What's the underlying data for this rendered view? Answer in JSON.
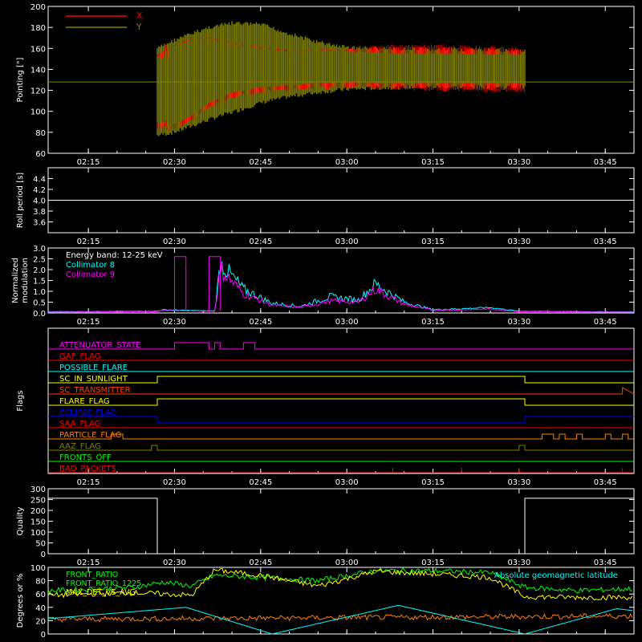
{
  "colors": {
    "background": "#000000",
    "axes": "#ffffff",
    "x_pointing": "#ff0000",
    "y_pointing": "#808000",
    "collimator8": "#00ffff",
    "collimator9": "#ff00ff"
  },
  "time_ticks": [
    "02:15",
    "02:30",
    "02:45",
    "03:00",
    "03:15",
    "03:30",
    "03:45"
  ],
  "chart_data": [
    {
      "type": "line",
      "ylabel": "Pointing [\"]",
      "ylim": [
        60,
        200
      ],
      "yticks": [
        "60",
        "80",
        "100",
        "120",
        "140",
        "160",
        "180",
        "200"
      ],
      "legend": [
        "X",
        "Y"
      ],
      "baseline_y": 128,
      "series": [
        {
          "name": "X",
          "color": "#ff0000",
          "x": [
            "02:27",
            "02:30",
            "02:33",
            "02:36",
            "02:40",
            "02:45",
            "02:50",
            "02:55",
            "03:00",
            "03:05",
            "03:10",
            "03:15",
            "03:20",
            "03:25",
            "03:31"
          ],
          "upper": [
            160,
            168,
            174,
            176,
            170,
            166,
            163,
            164,
            164,
            167,
            168,
            168,
            167,
            166,
            165
          ],
          "lower": [
            78,
            82,
            90,
            102,
            112,
            117,
            119,
            121,
            122,
            121,
            120,
            119,
            119,
            118,
            118
          ]
        },
        {
          "name": "Y",
          "color": "#808000",
          "x": [
            "02:27",
            "02:30",
            "02:33",
            "02:36",
            "02:40",
            "02:45",
            "02:50",
            "02:55",
            "03:00",
            "03:05",
            "03:10",
            "03:15",
            "03:20",
            "03:25",
            "03:31"
          ],
          "upper": [
            162,
            170,
            176,
            182,
            186,
            185,
            176,
            168,
            163,
            162,
            161,
            161,
            161,
            160,
            160
          ],
          "lower": [
            75,
            78,
            84,
            90,
            97,
            106,
            112,
            116,
            119,
            120,
            121,
            121,
            121,
            121,
            121
          ]
        }
      ]
    },
    {
      "type": "line",
      "ylabel": "Roll period [s]",
      "ylim": [
        3.4,
        4.6
      ],
      "yticks": [
        "3.6",
        "3.8",
        "4.0",
        "4.2",
        "4.4"
      ],
      "series": [
        {
          "x": [
            "02:08",
            "03:50"
          ],
          "y": [
            4.0,
            4.0
          ],
          "color": "#ffffff"
        }
      ]
    },
    {
      "type": "line",
      "ylabel": "Normalized modulation",
      "ylim": [
        0,
        3.0
      ],
      "yticks": [
        "0.0",
        "0.5",
        "1.0",
        "1.5",
        "2.0",
        "2.5",
        "3.0"
      ],
      "annotation": "Energy band: 12-25 keV",
      "legend": [
        "Collimator 8",
        "Collimator 9"
      ],
      "series": [
        {
          "name": "Collimator 8",
          "color": "#00ffff",
          "x": [
            "02:08",
            "02:27",
            "02:28",
            "02:35",
            "02:37",
            "02:38",
            "02:42",
            "02:47",
            "02:52",
            "02:57",
            "03:02",
            "03:05",
            "03:10",
            "03:15",
            "03:25",
            "03:30",
            "03:50"
          ],
          "y": [
            0.06,
            0.08,
            0.15,
            0.1,
            0.1,
            2.3,
            1.1,
            0.45,
            0.3,
            0.75,
            0.6,
            1.35,
            0.5,
            0.15,
            0.25,
            0.08,
            0.05
          ]
        },
        {
          "name": "Collimator 9",
          "color": "#ff00ff",
          "x": [
            "02:08",
            "02:27",
            "02:28",
            "02:35",
            "02:37",
            "02:38",
            "02:42",
            "02:47",
            "02:52",
            "02:57",
            "03:02",
            "03:05",
            "03:10",
            "03:15",
            "03:25",
            "03:30",
            "03:50"
          ],
          "y": [
            0.04,
            0.06,
            0.12,
            0.08,
            0.08,
            2.0,
            0.9,
            0.35,
            0.25,
            0.55,
            0.5,
            1.1,
            0.4,
            0.12,
            0.18,
            0.06,
            0.04
          ]
        }
      ]
    },
    {
      "type": "line",
      "ylabel": "Flags",
      "flags": [
        {
          "label": "ATTENUATOR_STATE",
          "color": "#ff00ff"
        },
        {
          "label": "GAP_FLAG",
          "color": "#ff0000"
        },
        {
          "label": "POSSIBLE_FLARE",
          "color": "#00ffff"
        },
        {
          "label": "SC_IN_SUNLIGHT",
          "color": "#ffff00"
        },
        {
          "label": "SC_TRANSMITTER",
          "color": "#ff4000"
        },
        {
          "label": "FLARE_FLAG",
          "color": "#ffff00"
        },
        {
          "label": "ECLIPSE_FLAG",
          "color": "#0000ff"
        },
        {
          "label": "SAA_FLAG",
          "color": "#ff0000"
        },
        {
          "label": "PARTICLE_FLAG",
          "color": "#ff8000"
        },
        {
          "label": "AAZ_FLAG",
          "color": "#808000"
        },
        {
          "label": "FRONTS_OFF",
          "color": "#00ff00"
        },
        {
          "label": "BAD_PACKETS",
          "color": "#ff0000"
        }
      ]
    },
    {
      "type": "line",
      "ylabel": "Quality",
      "ylim": [
        0,
        300
      ],
      "yticks": [
        "0",
        "50",
        "100",
        "150",
        "200",
        "250",
        "300"
      ],
      "series": [
        {
          "color": "#ffffff",
          "x": [
            "02:08",
            "02:27",
            "02:27",
            "03:31",
            "03:31",
            "03:50"
          ],
          "y": [
            256,
            256,
            0,
            0,
            256,
            256
          ]
        }
      ]
    },
    {
      "type": "line",
      "ylabel": "Degrees or %",
      "ylim": [
        0,
        100
      ],
      "yticks": [
        "0",
        "20",
        "40",
        "60",
        "80",
        "100"
      ],
      "legend": [
        "FRONT_RATIO",
        "FRONT_RATIO_1225",
        "MAX_DET_VS_AVG",
        "Absolute geomagnetic latitude"
      ],
      "series": [
        {
          "name": "FRONT_RATIO",
          "color": "#00ff00",
          "x": [
            "02:08",
            "02:23",
            "02:28",
            "02:33",
            "02:37",
            "02:45",
            "02:55",
            "03:05",
            "03:15",
            "03:25",
            "03:31",
            "03:40",
            "03:50"
          ],
          "y": [
            65,
            70,
            78,
            72,
            88,
            85,
            80,
            95,
            95,
            92,
            70,
            65,
            68
          ]
        },
        {
          "name": "FRONT_RATIO_1225",
          "color": "#ffff00",
          "x": [
            "02:08",
            "02:23",
            "02:28",
            "02:33",
            "02:37",
            "02:45",
            "02:55",
            "03:05",
            "03:15",
            "03:25",
            "03:31",
            "03:40",
            "03:50"
          ],
          "y": [
            58,
            62,
            60,
            58,
            96,
            88,
            72,
            94,
            90,
            85,
            56,
            55,
            55
          ]
        },
        {
          "name": "MAX_DET_VS_AVG",
          "color": "#ff8000",
          "x": [
            "02:08",
            "03:50"
          ],
          "y": [
            22,
            27
          ]
        },
        {
          "name": "Absolute geomagnetic latitude",
          "color": "#00ffff",
          "x": [
            "02:08",
            "02:32",
            "02:47",
            "03:09",
            "03:31",
            "03:47",
            "03:50"
          ],
          "y": [
            23,
            40,
            0,
            43,
            0,
            38,
            35
          ]
        }
      ]
    }
  ]
}
